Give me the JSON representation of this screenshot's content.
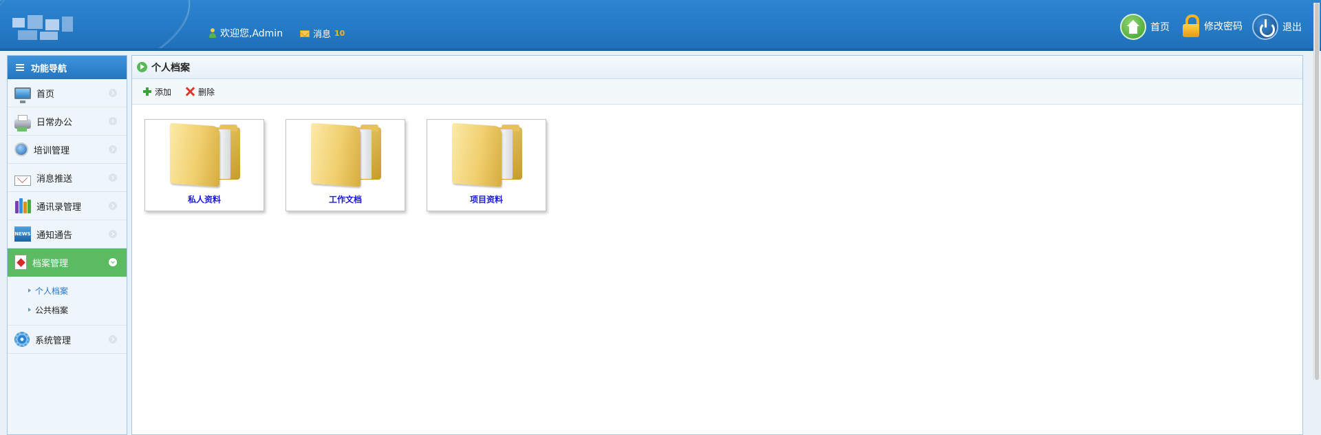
{
  "header": {
    "welcome_text": "欢迎您,Admin",
    "message_label": "消息",
    "message_count": "10",
    "home_label": "首页",
    "change_password_label": "修改密码",
    "logout_label": "退出"
  },
  "sidebar": {
    "title": "功能导航",
    "items": [
      {
        "label": "首页",
        "icon": "monitor-icon"
      },
      {
        "label": "日常办公",
        "icon": "printer-icon"
      },
      {
        "label": "培训管理",
        "icon": "globe-icon"
      },
      {
        "label": "消息推送",
        "icon": "mail-icon"
      },
      {
        "label": "通讯录管理",
        "icon": "books-icon"
      },
      {
        "label": "通知通告",
        "icon": "news-icon"
      },
      {
        "label": "档案管理",
        "icon": "pdf-icon",
        "active": true
      },
      {
        "label": "系统管理",
        "icon": "gear-icon"
      }
    ],
    "sub_items": [
      {
        "label": "个人档案",
        "current": true
      },
      {
        "label": "公共档案"
      }
    ],
    "news_icon_text": "NEWS"
  },
  "main": {
    "title": "个人档案",
    "toolbar": {
      "add_label": "添加",
      "delete_label": "删除"
    },
    "folders": [
      {
        "label": "私人资料"
      },
      {
        "label": "工作文档"
      },
      {
        "label": "项目资料"
      }
    ]
  },
  "colors": {
    "header_blue": "#2479c4",
    "active_green": "#5bbb61",
    "folder_label_blue": "#1a1ad8"
  }
}
